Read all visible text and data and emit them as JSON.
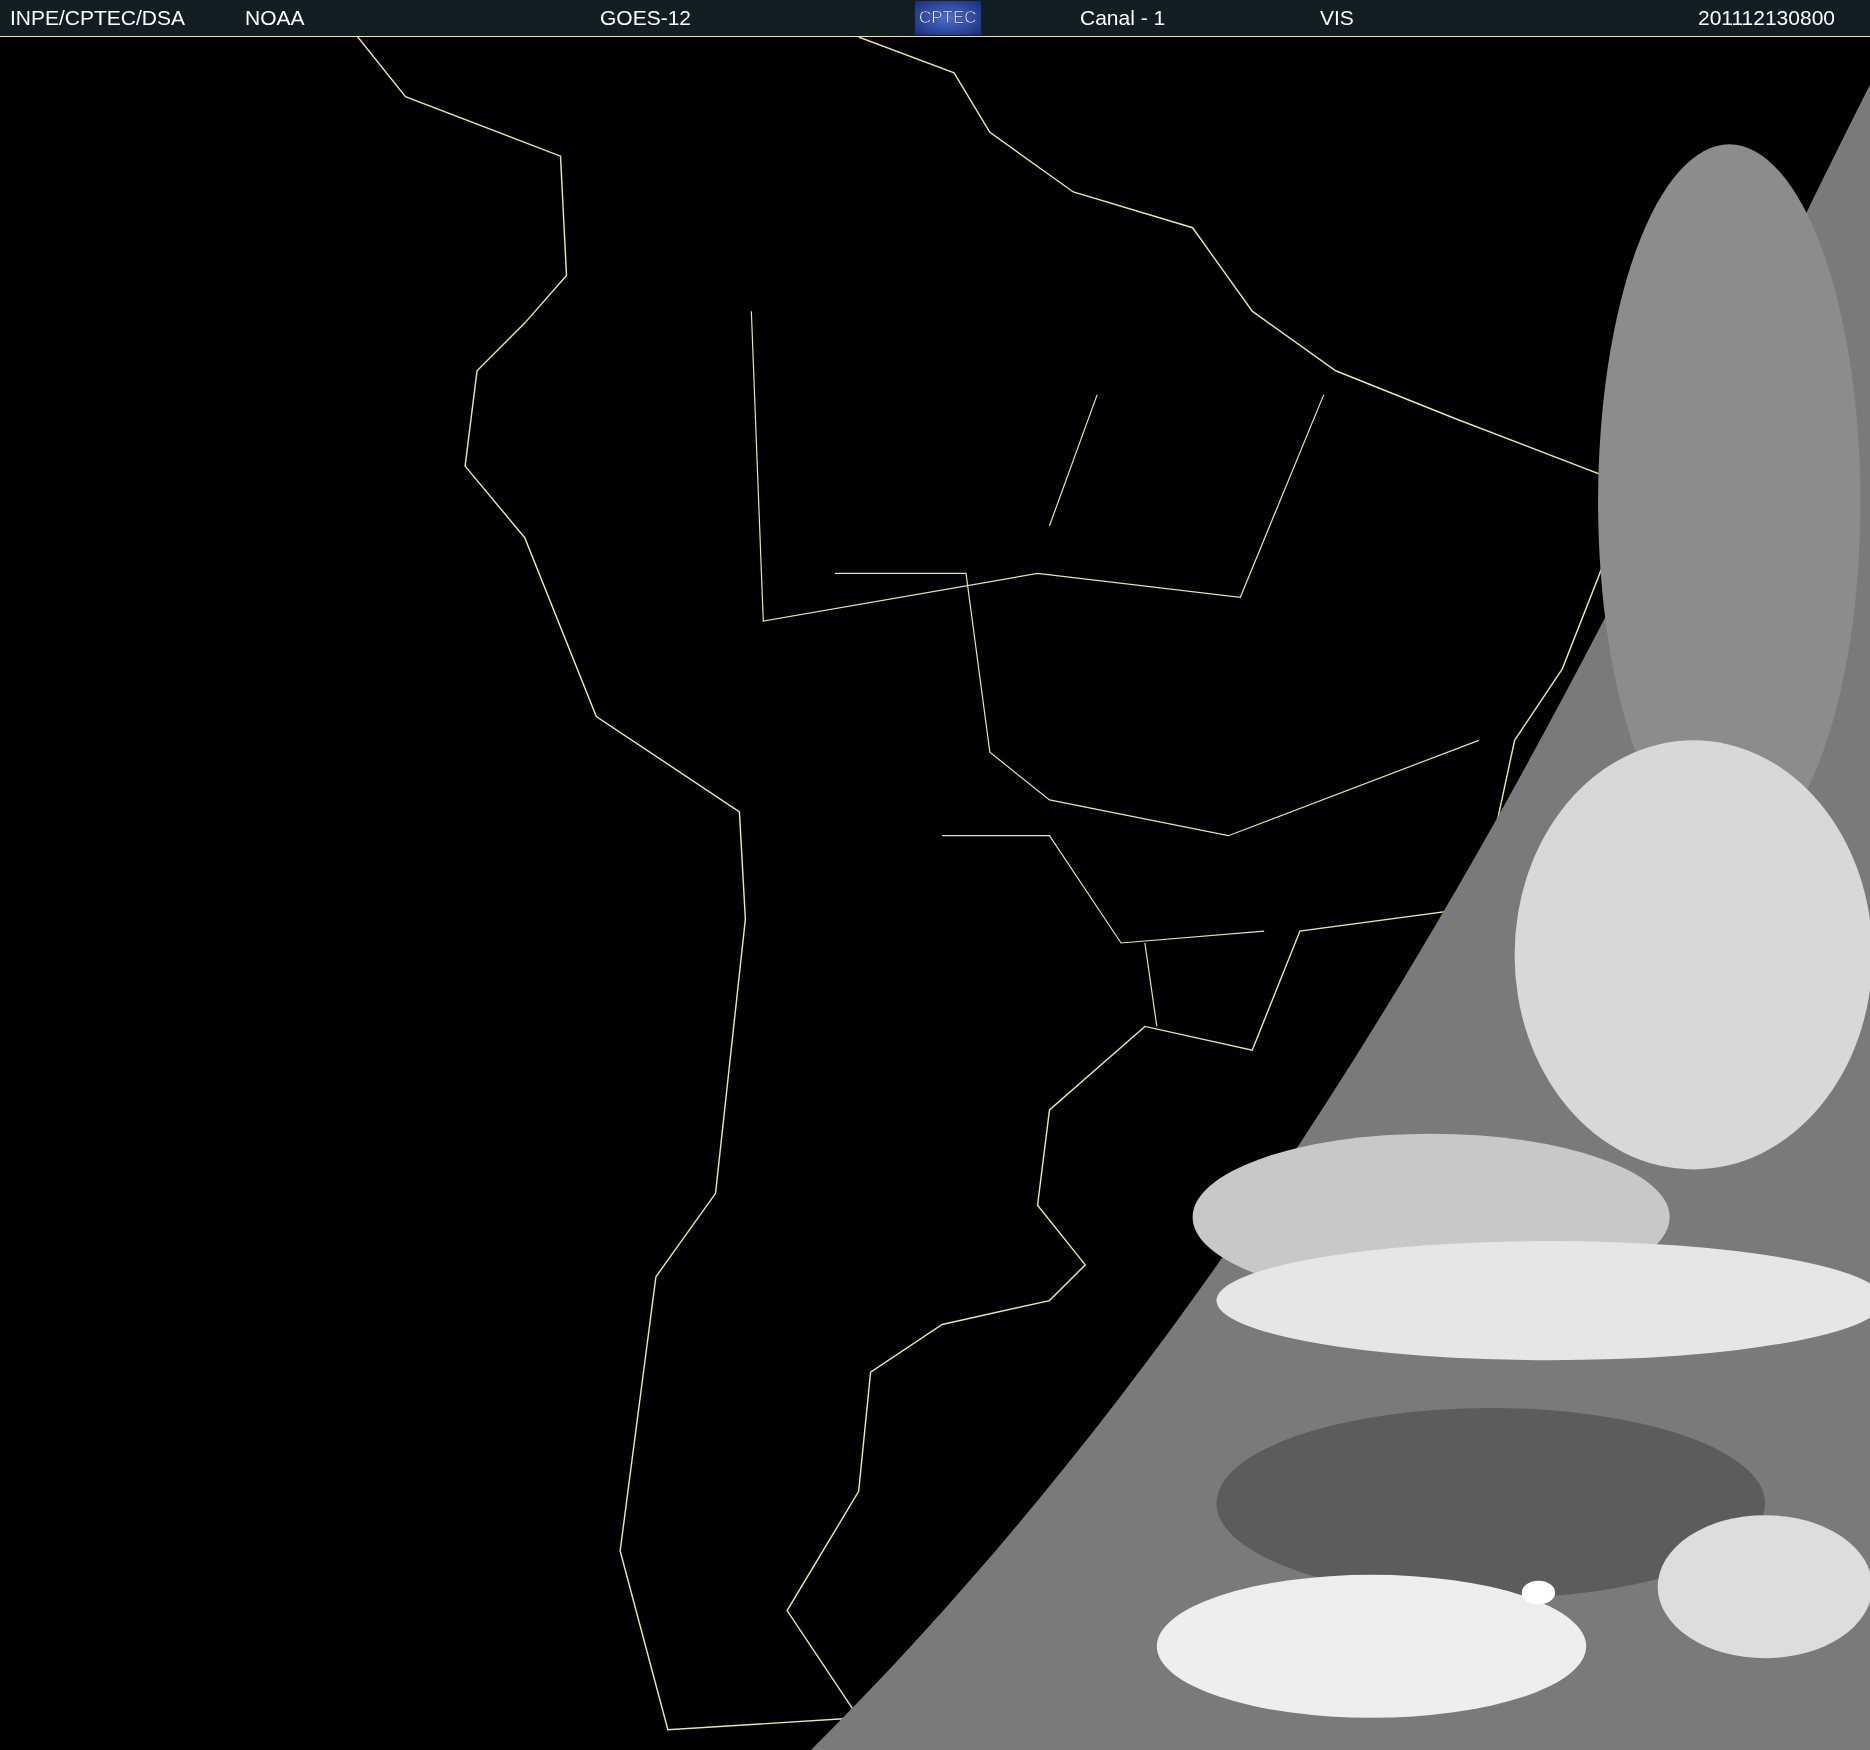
{
  "header": {
    "source": "INPE/CPTEC/DSA",
    "agency": "NOAA",
    "satellite": "GOES-12",
    "logo": "CPTEC",
    "channel": "Canal - 1",
    "band": "VIS",
    "timestamp": "201112130800"
  }
}
